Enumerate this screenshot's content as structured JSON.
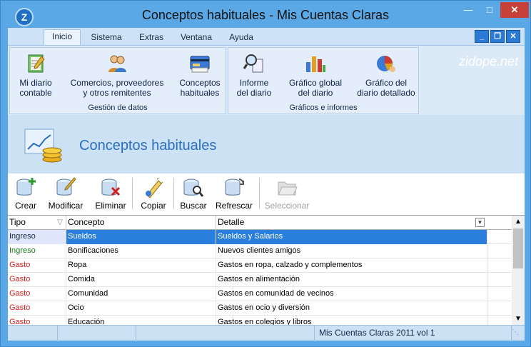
{
  "window": {
    "title": "Conceptos habituales - Mis Cuentas Claras",
    "app_letter": "Z"
  },
  "ribbon_tabs": [
    {
      "label": "Inicio",
      "active": true
    },
    {
      "label": "Sistema"
    },
    {
      "label": "Extras"
    },
    {
      "label": "Ventana"
    },
    {
      "label": "Ayuda"
    }
  ],
  "brand": {
    "logo": "zidope.net"
  },
  "ribbon": {
    "groups": [
      {
        "label": "Gestión de datos",
        "buttons": [
          {
            "line1": "Mi diario",
            "line2": "contable",
            "icon": "notebook-icon"
          },
          {
            "line1": "Comercios, proveedores",
            "line2": "y otros remitentes",
            "icon": "people-icon"
          },
          {
            "line1": "Conceptos",
            "line2": "habituales",
            "icon": "card-icon"
          }
        ]
      },
      {
        "label": "Gráficos e informes",
        "buttons": [
          {
            "line1": "Informe",
            "line2": "del diario",
            "icon": "magnifier-report-icon"
          },
          {
            "line1": "Gráfico global",
            "line2": "del diario",
            "icon": "bar-chart-icon"
          },
          {
            "line1": "Gráfico del",
            "line2": "diario detallado",
            "icon": "pie-chart-icon"
          }
        ]
      }
    ]
  },
  "banner": {
    "title": "Conceptos habituales",
    "icon": "coins-chart-icon"
  },
  "toolbar": [
    {
      "label": "Crear",
      "icon": "db-add-icon",
      "enabled": true
    },
    {
      "label": "Modificar",
      "icon": "db-edit-icon",
      "enabled": true
    },
    {
      "label": "Eliminar",
      "icon": "db-delete-icon",
      "enabled": true
    },
    {
      "label": "Copiar",
      "icon": "db-copy-icon",
      "enabled": true
    },
    {
      "label": "Buscar",
      "icon": "db-search-icon",
      "enabled": true
    },
    {
      "label": "Refrescar",
      "icon": "db-refresh-icon",
      "enabled": true
    },
    {
      "label": "Seleccionar",
      "icon": "folder-open-icon",
      "enabled": false
    }
  ],
  "grid": {
    "columns": [
      "Tipo",
      "Concepto",
      "Detalle"
    ],
    "rows": [
      {
        "tipo": "Ingreso",
        "concepto": "Sueldos",
        "detalle": "Sueldos y Salarios",
        "selected": true
      },
      {
        "tipo": "Ingreso",
        "concepto": "Bonificaciones",
        "detalle": "Nuevos clientes amigos"
      },
      {
        "tipo": "Gasto",
        "concepto": "Ropa",
        "detalle": "Gastos en ropa, calzado y complementos"
      },
      {
        "tipo": "Gasto",
        "concepto": "Comida",
        "detalle": "Gastos en alimentación"
      },
      {
        "tipo": "Gasto",
        "concepto": "Comunidad",
        "detalle": "Gastos en comunidad de vecinos"
      },
      {
        "tipo": "Gasto",
        "concepto": "Ocio",
        "detalle": "Gastos en ocio y diversión"
      },
      {
        "tipo": "Gasto",
        "concepto": "Educación",
        "detalle": "Gastos en colegios y libros"
      }
    ]
  },
  "status": {
    "version": "Mis Cuentas Claras 2011 vol 1"
  },
  "colors": {
    "ingreso": "#1a7a1a",
    "gasto": "#d12020",
    "accent": "#2a7fdc",
    "titlebar": "#5aa9e6"
  }
}
